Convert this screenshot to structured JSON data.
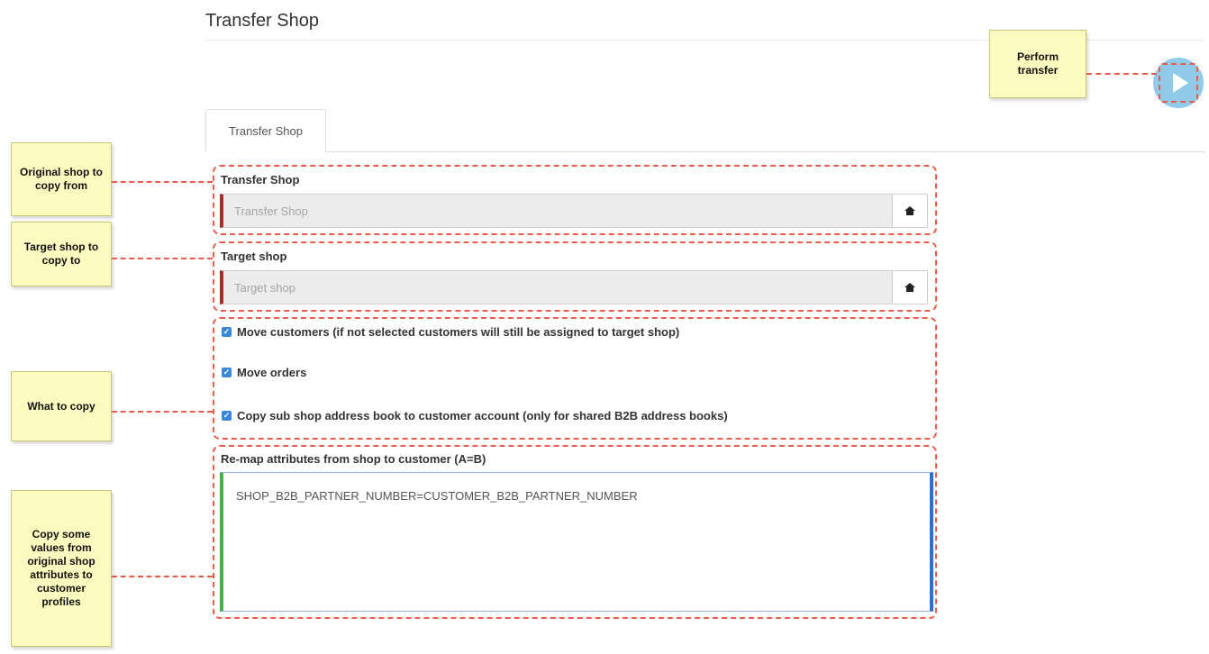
{
  "page": {
    "title": "Transfer Shop"
  },
  "tabs": [
    {
      "label": "Transfer Shop"
    }
  ],
  "form": {
    "transfer_shop": {
      "label": "Transfer Shop",
      "placeholder": "Transfer Shop",
      "value": "",
      "button_icon": "home-icon"
    },
    "target_shop": {
      "label": "Target shop",
      "placeholder": "Target shop",
      "value": "",
      "button_icon": "home-icon"
    },
    "options": [
      {
        "label": "Move customers (if not selected customers will still be assigned to target shop)",
        "checked": true
      },
      {
        "label": "Move orders",
        "checked": true
      },
      {
        "label": "Copy sub shop address book to customer account (only for shared B2B address books)",
        "checked": true
      }
    ],
    "remap": {
      "label": "Re-map attributes from shop to customer (A=B)",
      "value": "SHOP_B2B_PARTNER_NUMBER=CUSTOMER_B2B_PARTNER_NUMBER"
    }
  },
  "run_button_icon": "play-icon",
  "annotations": {
    "perform": "Perform transfer",
    "original": "Original shop to copy from",
    "target": "Target shop to copy to",
    "what": "What to copy",
    "copy_values": "Copy some values from original shop attributes to customer profiles"
  },
  "colors": {
    "annotation_dash": "#ef5b4b",
    "note_bg": "#fdfcc0",
    "checkbox": "#3a87d9",
    "run_button": "#8fcbe8"
  }
}
